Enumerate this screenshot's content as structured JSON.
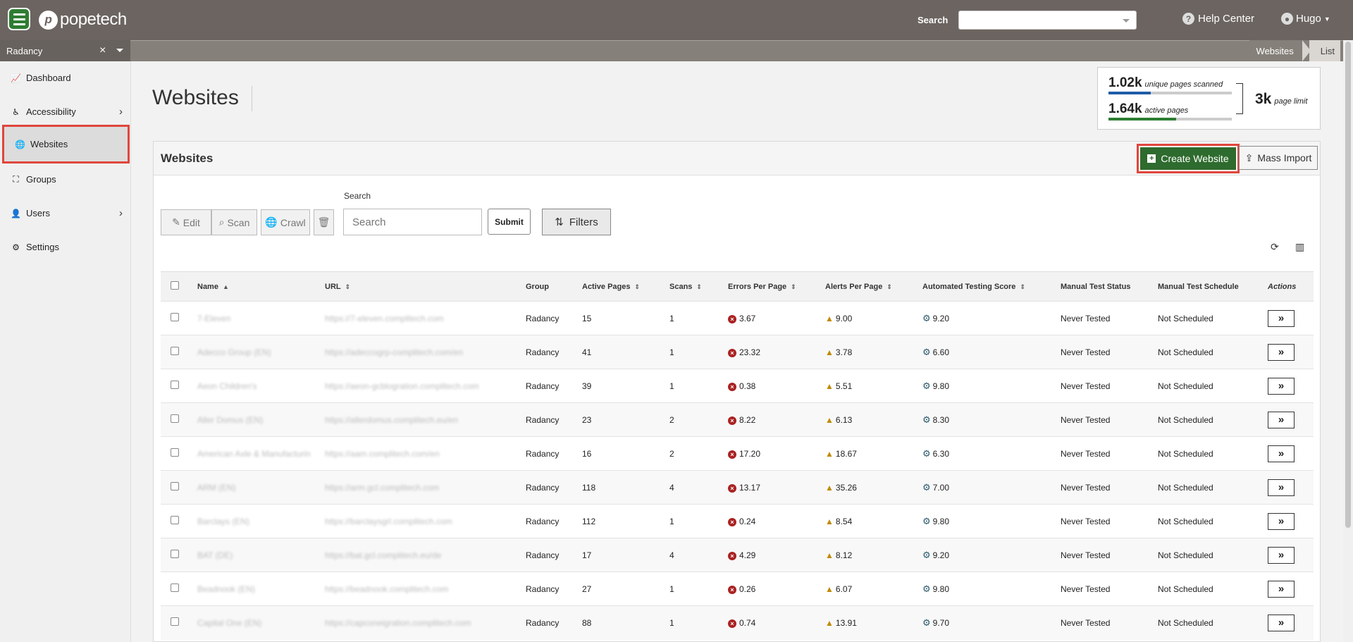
{
  "topbar": {
    "brand": "popetech",
    "search_label": "Search",
    "help_label": "Help Center",
    "user_name": "Hugo"
  },
  "subbar": {
    "org_name": "Radancy",
    "clear_icon": "×",
    "breadcrumbs": [
      "Websites",
      "List"
    ]
  },
  "sidebar": {
    "items": [
      {
        "label": "Dashboard",
        "icon": "chart-icon"
      },
      {
        "label": "Accessibility",
        "icon": "accessibility-icon"
      },
      {
        "label": "Websites",
        "icon": "globe-icon"
      },
      {
        "label": "Groups",
        "icon": "sitemap-icon"
      },
      {
        "label": "Users",
        "icon": "user-icon"
      },
      {
        "label": "Settings",
        "icon": "gear-icon"
      }
    ]
  },
  "page": {
    "title": "Websites"
  },
  "stats": {
    "unique_value": "1.02k",
    "unique_label": "unique pages scanned",
    "active_value": "1.64k",
    "active_label": "active pages",
    "limit_value": "3k",
    "limit_label": "page limit",
    "unique_fraction": 0.34,
    "active_fraction": 0.55,
    "unique_color": "#1f5ca8",
    "active_color": "#2e7d32"
  },
  "card": {
    "title": "Websites",
    "create_label": "Create Website",
    "mass_label": "Mass Import"
  },
  "toolbar": {
    "edit": "Edit",
    "scan": "Scan",
    "crawl": "Crawl",
    "search_label": "Search",
    "search_placeholder": "Search",
    "submit": "Submit",
    "filters": "Filters"
  },
  "table": {
    "headers": [
      "Name",
      "URL",
      "Group",
      "Active Pages",
      "Scans",
      "Errors Per Page",
      "Alerts Per Page",
      "Automated Testing Score",
      "Manual Test Status",
      "Manual Test Schedule",
      "Actions"
    ],
    "rows": [
      {
        "name": "7-Eleven",
        "url": "https://7-eleven.complitech.com",
        "group": "Radancy",
        "active": "15",
        "scans": "1",
        "errors": "3.67",
        "alerts": "9.00",
        "score": "9.20",
        "status": "Never Tested",
        "schedule": "Not Scheduled"
      },
      {
        "name": "Adecco Group (EN)",
        "url": "https://adeccogrp-complitech.com/en",
        "group": "Radancy",
        "active": "41",
        "scans": "1",
        "errors": "23.32",
        "alerts": "3.78",
        "score": "6.60",
        "status": "Never Tested",
        "schedule": "Not Scheduled"
      },
      {
        "name": "Aeon Children's",
        "url": "https://aeon-gcblogration.complitech.com",
        "group": "Radancy",
        "active": "39",
        "scans": "1",
        "errors": "0.38",
        "alerts": "5.51",
        "score": "9.80",
        "status": "Never Tested",
        "schedule": "Not Scheduled"
      },
      {
        "name": "Aller Domus (EN)",
        "url": "https://allerdomus.complitech.eu/en",
        "group": "Radancy",
        "active": "23",
        "scans": "2",
        "errors": "8.22",
        "alerts": "6.13",
        "score": "8.30",
        "status": "Never Tested",
        "schedule": "Not Scheduled"
      },
      {
        "name": "American Axle & Manufacturin",
        "url": "https://aam.complitech.com/en",
        "group": "Radancy",
        "active": "16",
        "scans": "2",
        "errors": "17.20",
        "alerts": "18.67",
        "score": "6.30",
        "status": "Never Tested",
        "schedule": "Not Scheduled"
      },
      {
        "name": "ARM (EN)",
        "url": "https://arm.gcl.complitech.com",
        "group": "Radancy",
        "active": "118",
        "scans": "4",
        "errors": "13.17",
        "alerts": "35.26",
        "score": "7.00",
        "status": "Never Tested",
        "schedule": "Not Scheduled"
      },
      {
        "name": "Barclays (EN)",
        "url": "https://barclaysgrl.complitech.com",
        "group": "Radancy",
        "active": "112",
        "scans": "1",
        "errors": "0.24",
        "alerts": "8.54",
        "score": "9.80",
        "status": "Never Tested",
        "schedule": "Not Scheduled"
      },
      {
        "name": "BAT (DE)",
        "url": "https://bat.gcl.complitech.eu/de",
        "group": "Radancy",
        "active": "17",
        "scans": "4",
        "errors": "4.29",
        "alerts": "8.12",
        "score": "9.20",
        "status": "Never Tested",
        "schedule": "Not Scheduled"
      },
      {
        "name": "Beadnook (EN)",
        "url": "https://beadnook.complitech.com",
        "group": "Radancy",
        "active": "27",
        "scans": "1",
        "errors": "0.26",
        "alerts": "6.07",
        "score": "9.80",
        "status": "Never Tested",
        "schedule": "Not Scheduled"
      },
      {
        "name": "Capital One (EN)",
        "url": "https://capconeigration.complitech.com",
        "group": "Radancy",
        "active": "88",
        "scans": "1",
        "errors": "0.74",
        "alerts": "13.91",
        "score": "9.70",
        "status": "Never Tested",
        "schedule": "Not Scheduled"
      }
    ]
  },
  "colors": {
    "topbar": "#6b6460",
    "primary_button": "#2e6b2e",
    "highlight": "#e0463d"
  }
}
